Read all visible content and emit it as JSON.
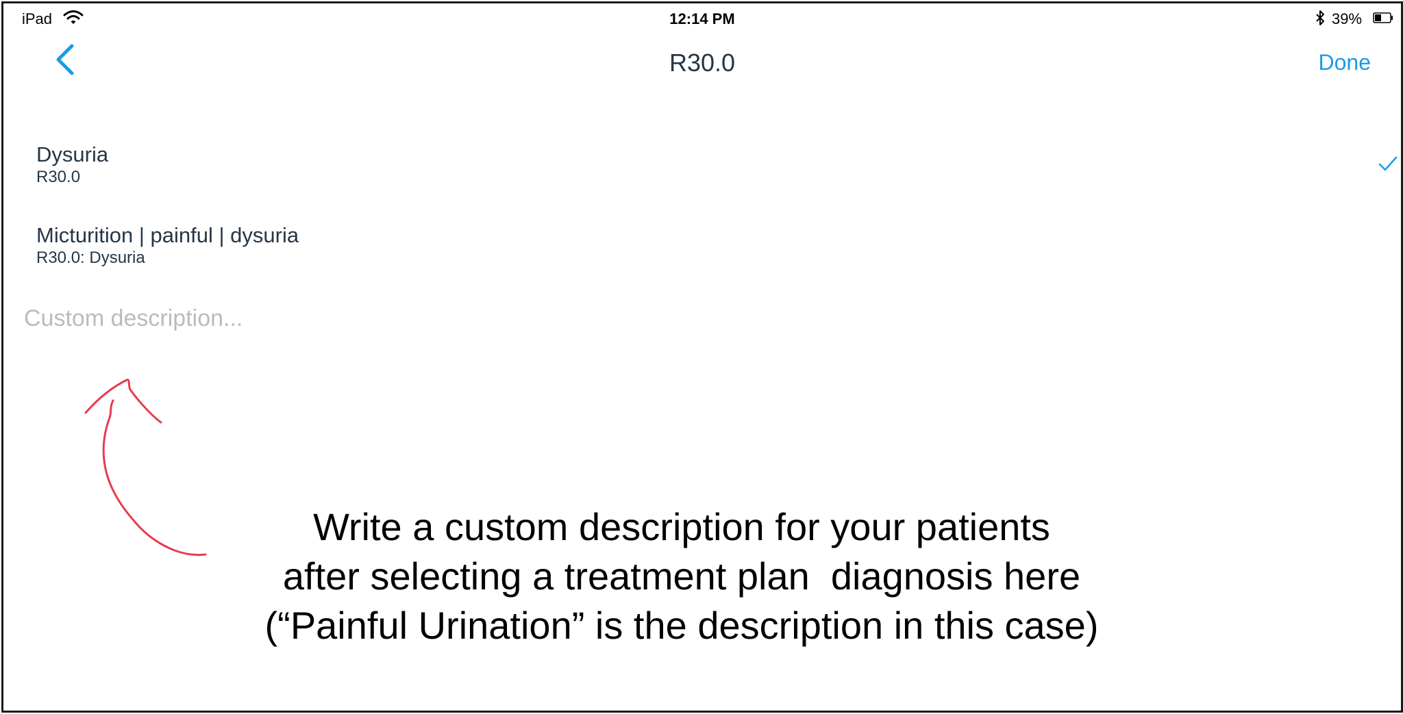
{
  "status_bar": {
    "device": "iPad",
    "time": "12:14 PM",
    "battery": "39%",
    "icons": [
      "wifi-icon",
      "bluetooth-icon",
      "battery-icon"
    ]
  },
  "nav": {
    "back_icon": "chevron-left-icon",
    "title": "R30.0",
    "done_label": "Done"
  },
  "rows": [
    {
      "title": "Dysuria",
      "subtitle": "R30.0",
      "selected": true
    },
    {
      "title": "Micturition | painful | dysuria",
      "subtitle": "R30.0: Dysuria",
      "selected": false
    }
  ],
  "custom_description": {
    "placeholder": "Custom description...",
    "value": ""
  },
  "annotation": {
    "lines": [
      "Write a custom description for your patients",
      "after selecting a treatment plan  diagnosis here",
      "(“Painful Urination” is the description in this case)"
    ]
  },
  "colors": {
    "accent": "#1a9be6",
    "text": "#253646",
    "placeholder": "#b9bcbf",
    "annotation_arrow": "#e83a4f"
  }
}
